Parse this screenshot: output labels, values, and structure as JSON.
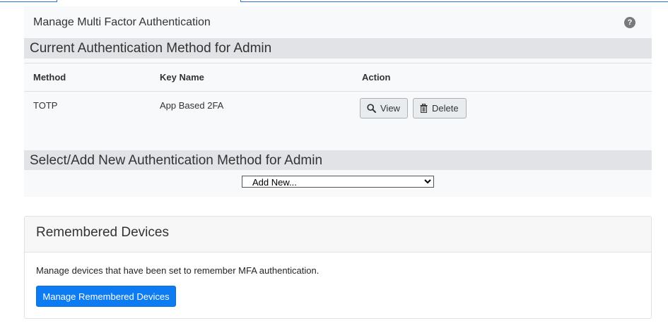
{
  "panel": {
    "title": "Manage Multi Factor Authentication",
    "help_glyph": "?"
  },
  "current_section": {
    "heading": "Current Authentication Method for Admin",
    "columns": [
      "Method",
      "Key Name",
      "Action"
    ],
    "rows": [
      {
        "method": "TOTP",
        "key_name": "App Based 2FA",
        "view_label": "View",
        "delete_label": "Delete"
      }
    ]
  },
  "add_section": {
    "heading": "Select/Add New Authentication Method for Admin",
    "select_value": "Add New..."
  },
  "remembered_devices": {
    "title": "Remembered Devices",
    "description": "Manage devices that have been set to remember MFA authentication.",
    "button_label": "Manage Remembered Devices"
  },
  "colors": {
    "tab_border": "#2d6fd3",
    "primary": "#0d7cf2",
    "section_bar": "#e1e3e6",
    "panel_bg": "#f8f9fa"
  }
}
